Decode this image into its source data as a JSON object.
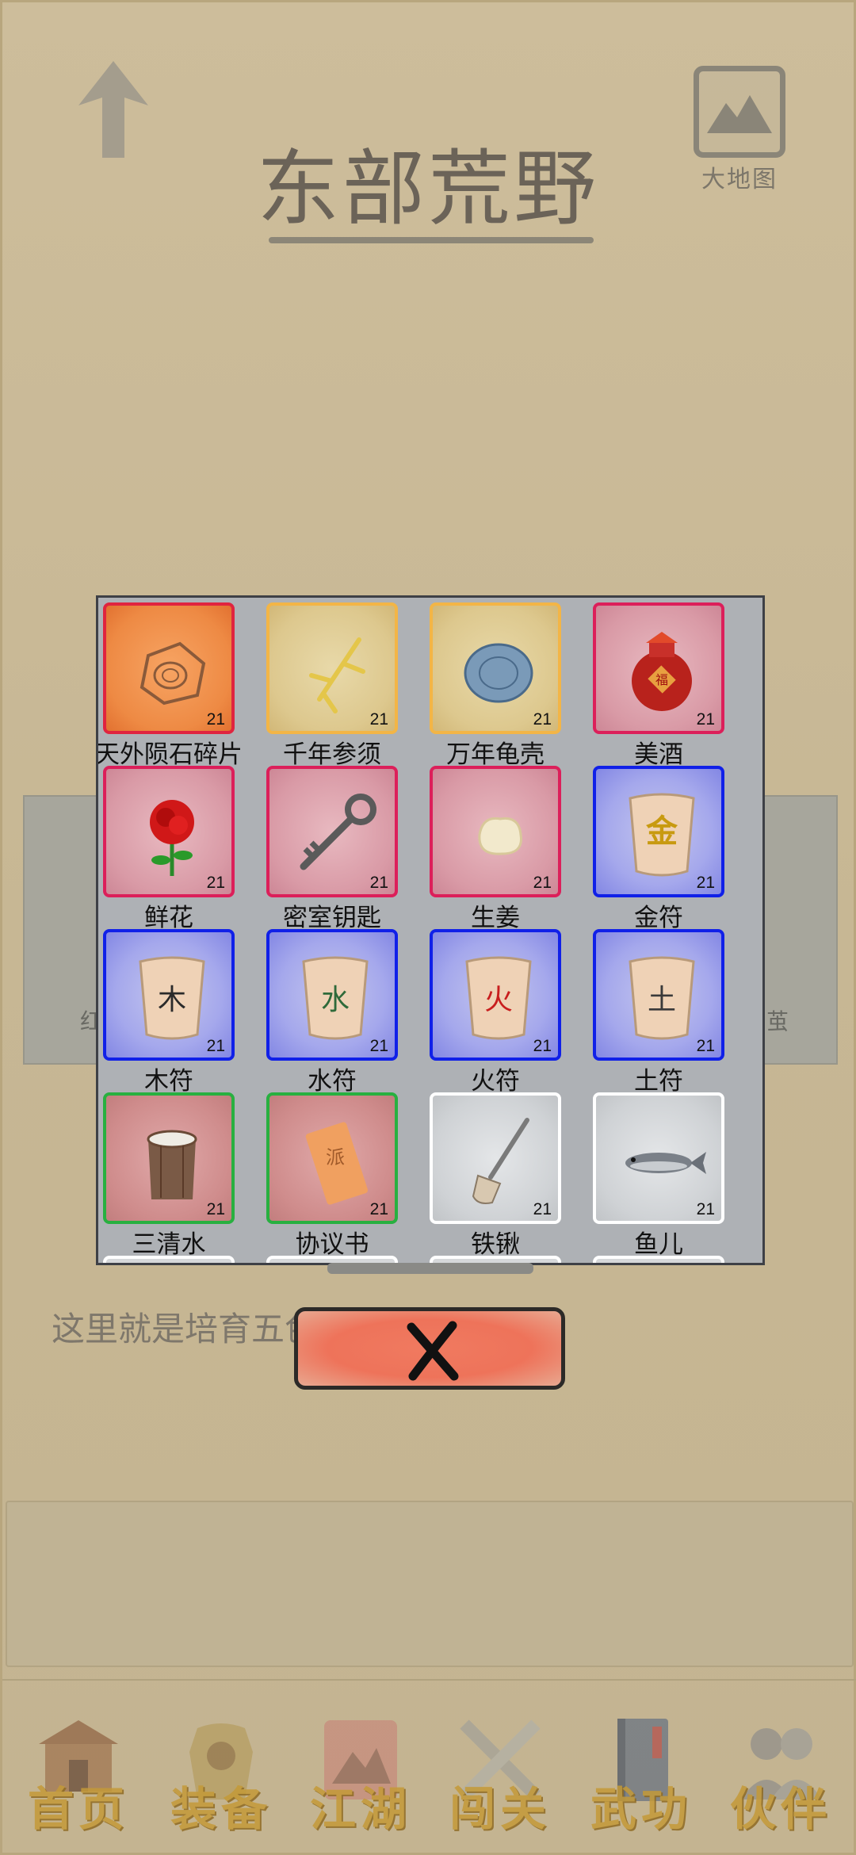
{
  "header": {
    "title": "东部荒野",
    "map_label": "大地图",
    "back_icon": "up-arrow-icon",
    "map_icon": "mountain-map-icon"
  },
  "background": {
    "card_left_text": "红",
    "card_right_text": "茧",
    "description": "这里就是培育五色"
  },
  "inventory": {
    "items": [
      {
        "name": "天外陨石碎片",
        "count": "21",
        "rarity": "orange",
        "icon": "meteorite-icon"
      },
      {
        "name": "千年参须",
        "count": "21",
        "rarity": "yellow",
        "icon": "ginseng-icon"
      },
      {
        "name": "万年龟壳",
        "count": "21",
        "rarity": "yellow",
        "icon": "turtle-shell-icon"
      },
      {
        "name": "美酒",
        "count": "21",
        "rarity": "red",
        "icon": "wine-jar-icon"
      },
      {
        "name": "鲜花",
        "count": "21",
        "rarity": "red",
        "icon": "rose-icon"
      },
      {
        "name": "密室钥匙",
        "count": "21",
        "rarity": "red",
        "icon": "key-icon"
      },
      {
        "name": "生姜",
        "count": "21",
        "rarity": "red",
        "icon": "ginger-icon"
      },
      {
        "name": "金符",
        "count": "21",
        "rarity": "blue",
        "icon": "talisman-icon",
        "glyph": "金",
        "glyph_color": "#c89a10"
      },
      {
        "name": "木符",
        "count": "21",
        "rarity": "blue",
        "icon": "talisman-icon",
        "glyph": "木",
        "glyph_color": "#2a2a2a"
      },
      {
        "name": "水符",
        "count": "21",
        "rarity": "blue",
        "icon": "talisman-icon",
        "glyph": "水",
        "glyph_color": "#2f6a3a"
      },
      {
        "name": "火符",
        "count": "21",
        "rarity": "blue",
        "icon": "talisman-icon",
        "glyph": "火",
        "glyph_color": "#c81e1e"
      },
      {
        "name": "土符",
        "count": "21",
        "rarity": "blue",
        "icon": "talisman-icon",
        "glyph": "土",
        "glyph_color": "#3a3a3a"
      },
      {
        "name": "三清水",
        "count": "21",
        "rarity": "green",
        "icon": "wooden-bucket-icon"
      },
      {
        "name": "协议书",
        "count": "21",
        "rarity": "green",
        "icon": "contract-icon",
        "glyph": "派"
      },
      {
        "name": "铁锹",
        "count": "21",
        "rarity": "white",
        "icon": "shovel-icon"
      },
      {
        "name": "鱼儿",
        "count": "21",
        "rarity": "white",
        "icon": "fish-icon"
      }
    ],
    "close_icon": "close-x-icon"
  },
  "nav": [
    {
      "label": "首页",
      "icon": "temple-icon"
    },
    {
      "label": "装备",
      "icon": "armor-icon"
    },
    {
      "label": "江湖",
      "icon": "scroll-map-icon"
    },
    {
      "label": "闯关",
      "icon": "crossed-swords-icon"
    },
    {
      "label": "武功",
      "icon": "manual-book-icon"
    },
    {
      "label": "伙伴",
      "icon": "companions-icon"
    }
  ]
}
